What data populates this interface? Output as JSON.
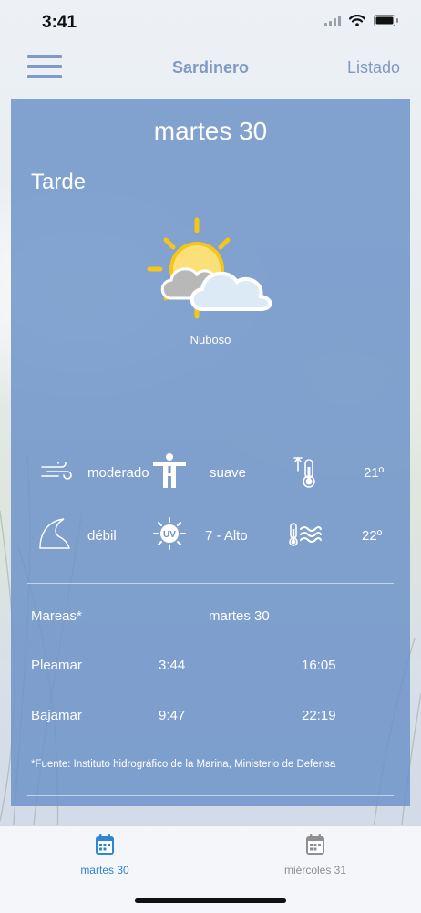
{
  "status_bar": {
    "time": "3:41"
  },
  "nav": {
    "title": "Sardinero",
    "right_label": "Listado"
  },
  "forecast": {
    "day": "martes 30",
    "period": "Tarde",
    "condition": "Nuboso",
    "wind": "moderado",
    "feels": "suave",
    "air_temp": "21º",
    "waves": "débil",
    "uv": "7 - Alto",
    "water_temp": "22º"
  },
  "tides": {
    "label": "Mareas*",
    "day": "martes 30",
    "high_label": "Pleamar",
    "high_times": [
      "3:44",
      "16:05"
    ],
    "low_label": "Bajamar",
    "low_times": [
      "9:47",
      "22:19"
    ],
    "source": "*Fuente: Instituto hidrográfico de la Marina, Ministerio de Defensa"
  },
  "tabs": [
    {
      "label": "martes 30",
      "active": true
    },
    {
      "label": "miércoles 31",
      "active": false
    }
  ],
  "colors": {
    "accent": "#2f86d6",
    "nav_tint": "#7f9ac6",
    "card": "#6d92c8",
    "inactive": "#8e8e93"
  }
}
